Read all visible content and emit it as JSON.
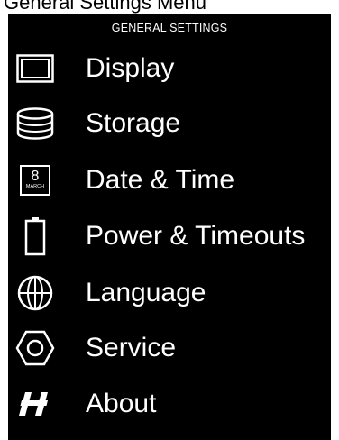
{
  "caption": "General Settings Menu",
  "header": {
    "title": "GENERAL SETTINGS"
  },
  "menu": {
    "items": [
      {
        "label": "Display",
        "icon": "display-icon"
      },
      {
        "label": "Storage",
        "icon": "storage-icon"
      },
      {
        "label": "Date & Time",
        "icon": "calendar-icon"
      },
      {
        "label": "Power & Timeouts",
        "icon": "battery-icon"
      },
      {
        "label": "Language",
        "icon": "globe-icon"
      },
      {
        "label": "Service",
        "icon": "hexagon-icon"
      },
      {
        "label": "About",
        "icon": "brand-logo-icon"
      }
    ],
    "calendar_icon": {
      "day": "8",
      "month": "MARCH"
    }
  },
  "colors": {
    "background": "#000000",
    "text": "#ffffff"
  }
}
